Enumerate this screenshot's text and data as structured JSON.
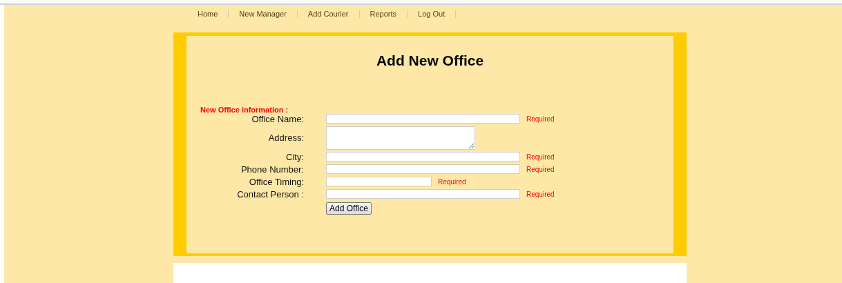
{
  "nav": [
    {
      "label": "Home"
    },
    {
      "label": "New Manager"
    },
    {
      "label": "Add Courier"
    },
    {
      "label": "Reports"
    },
    {
      "label": "Log Out"
    }
  ],
  "form": {
    "title": "Add New Office",
    "section_label": "New Office information :",
    "fields": [
      {
        "label": "Office Name:",
        "kind": "text",
        "note": "Required"
      },
      {
        "label": "Address:",
        "kind": "textarea"
      },
      {
        "label": "City:",
        "kind": "text",
        "note": "Required"
      },
      {
        "label": "Phone Number:",
        "kind": "text",
        "note": "Required"
      },
      {
        "label": "Office Timing:",
        "kind": "short_text",
        "note": "Required"
      },
      {
        "label": "Contact Person :",
        "kind": "text",
        "note": "Required"
      }
    ],
    "submit": "Add Office"
  }
}
